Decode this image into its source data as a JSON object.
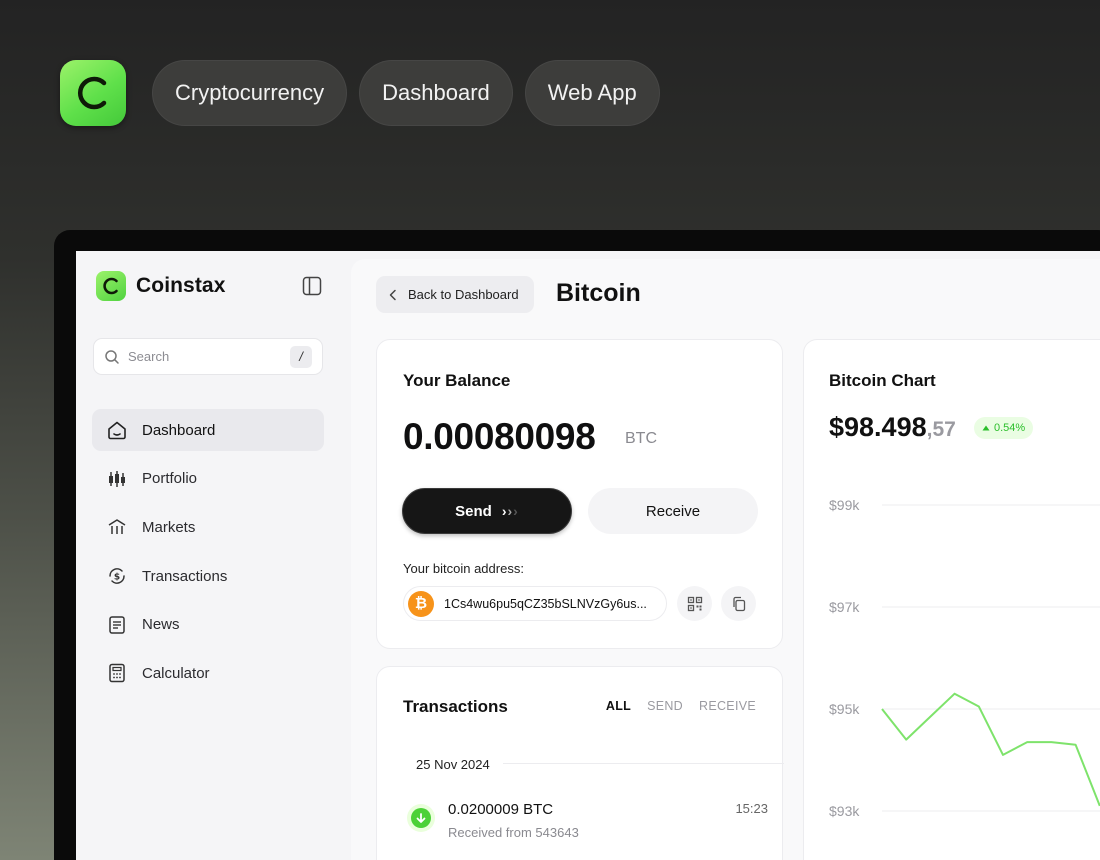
{
  "header": {
    "tags": [
      "Cryptocurrency",
      "Dashboard",
      "Web App"
    ]
  },
  "sidebar": {
    "brand": "Coinstax",
    "search_placeholder": "Search",
    "search_shortcut": "/",
    "items": [
      {
        "label": "Dashboard",
        "icon": "home-icon",
        "active": true
      },
      {
        "label": "Portfolio",
        "icon": "candlestick-icon",
        "active": false
      },
      {
        "label": "Markets",
        "icon": "markets-icon",
        "active": false
      },
      {
        "label": "Transactions",
        "icon": "transactions-icon",
        "active": false
      },
      {
        "label": "News",
        "icon": "news-icon",
        "active": false
      },
      {
        "label": "Calculator",
        "icon": "calculator-icon",
        "active": false
      }
    ]
  },
  "main": {
    "back_label": "Back to Dashboard",
    "title": "Bitcoin",
    "balance": {
      "title": "Your Balance",
      "amount": "0.00080098",
      "unit": "BTC",
      "send_label": "Send",
      "receive_label": "Receive",
      "address_label": "Your bitcoin address:",
      "address": "1Cs4wu6pu5qCZ35bSLNVzGy6us..."
    },
    "transactions": {
      "title": "Transactions",
      "filters": [
        "ALL",
        "SEND",
        "RECEIVE"
      ],
      "active_filter": "ALL",
      "date": "25 Nov 2024",
      "items": [
        {
          "amount": "0.0200009 BTC",
          "description": "Received from 543643",
          "time": "15:23",
          "direction": "received"
        }
      ]
    },
    "chart": {
      "title": "Bitcoin Chart",
      "price": "$98.498",
      "price_cents": ",57",
      "change": "0.54%",
      "change_direction": "up"
    }
  },
  "colors": {
    "accent_green": "#7ee36b",
    "positive": "#2bbf2b",
    "btc_orange": "#f7931a"
  },
  "chart_data": {
    "type": "line",
    "ytick_labels": [
      "$99k",
      "$97k",
      "$95k",
      "$93k"
    ],
    "ylim": [
      93000,
      99000
    ],
    "grid": true,
    "series": [
      {
        "values": [
          95000,
          94400,
          94850,
          95300,
          95050,
          94100,
          94350,
          94350,
          94300,
          93100
        ]
      }
    ]
  }
}
